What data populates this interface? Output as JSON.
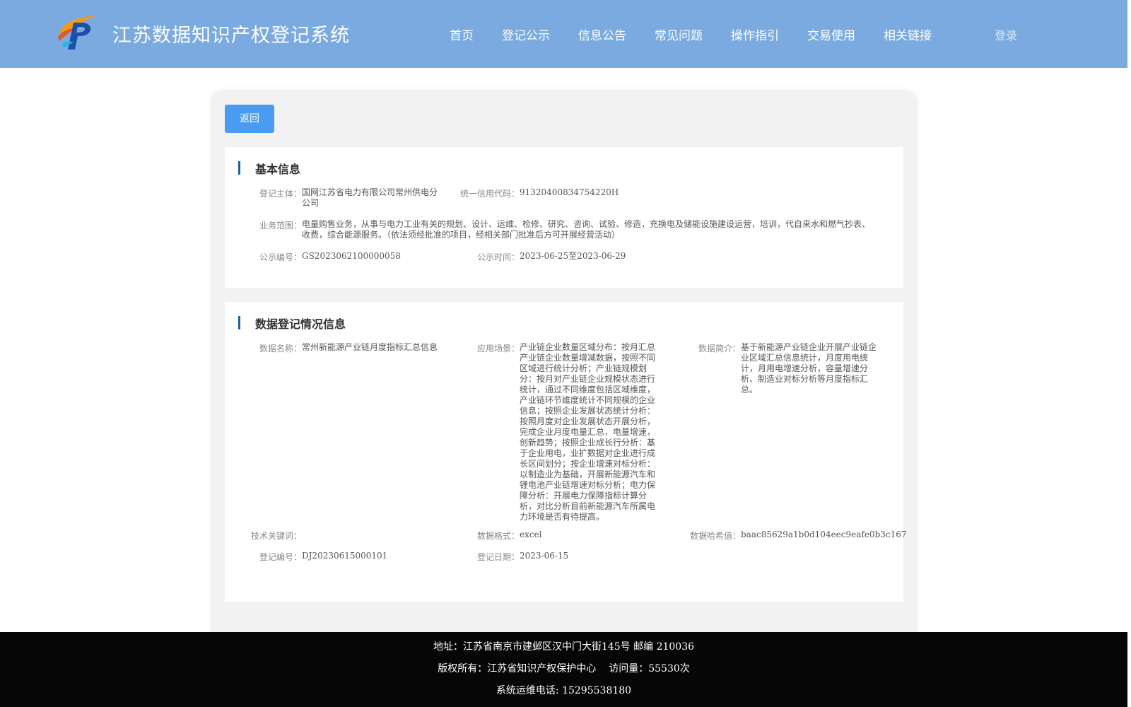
{
  "header": {
    "site_title": "江苏数据知识产权登记系统",
    "nav": [
      "首页",
      "登记公示",
      "信息公告",
      "常见问题",
      "操作指引",
      "交易使用",
      "相关链接"
    ],
    "login_label": "登录"
  },
  "main": {
    "back_label": "返回",
    "basic_info": {
      "title": "基本信息",
      "subject_label": "登记主体：",
      "subject_value": "国网江苏省电力有限公司常州供电分公司",
      "credit_label": "统一信用代码：",
      "credit_value": "91320400834754220H",
      "scope_label": "业务范围：",
      "scope_value": "电量购售业务，从事与电力工业有关的规划、设计、运维、检修、研究、咨询、试验、修造，充换电及储能设施建设运营，培训，代自来水和燃气抄表、收费，综合能源服务。（依法须经批准的项目，经相关部门批准后方可开展经营活动）",
      "pub_no_label": "公示编号：",
      "pub_no_value": "GS2023062100000058",
      "pub_time_label": "公示时间：",
      "pub_time_value": "2023-06-25至2023-06-29"
    },
    "registration": {
      "title": "数据登记情况信息",
      "data_name_label": "数据名称：",
      "data_name_value": "常州新能源产业链月度指标汇总信息",
      "scenario_label": "应用场景：",
      "scenario_value": "产业链企业数量区域分布：按月汇总产业链企业数量增减数据，按照不同区域进行统计分析；产业链规模划分：按月对产业链企业规模状态进行统计，通过不同维度包括区域维度，产业链环节维度统计不同规模的企业信息；按照企业发展状态统计分析：按照月度对企业发展状态开展分析，完成企业月度电量汇总，电量增速，创新趋势；按照企业成长行分析：基于企业用电，业扩数据对企业进行成长区间划分；按企业增速对标分析：以制造业为基础，开展新能源汽车和锂电池产业链增速对标分析；电力保障分析：开展电力保障指标计算分析，对比分析目前新能源汽车所属电力环境是否有待提高。",
      "intro_label": "数据简介：",
      "intro_value": "基于新能源产业链企业开展产业链企业区域汇总信息统计，月度用电统计，月用电增速分析，容量增速分析、制造业对标分析等月度指标汇总。",
      "keywords_label": "技术关键词：",
      "keywords_value": "",
      "format_label": "数据格式：",
      "format_value": "excel",
      "hash_label": "数据哈希值：",
      "hash_value": "baac85629a1b0d104eec9eafe0b3c167",
      "reg_no_label": "登记编号：",
      "reg_no_value": "DJ20230615000101",
      "reg_date_label": "登记日期：",
      "reg_date_value": "2023-06-15"
    }
  },
  "footer": {
    "address": "地址：江苏省南京市建邺区汉中门大街145号 邮编 210036",
    "copyright": "版权所有：江苏省知识产权保护中心",
    "visits": "访问量：55530次",
    "phone": "系统运维电话: 15295538180"
  },
  "colors": {
    "header_bg": "#7aaadf",
    "button_blue": "#4a9cf2",
    "section_bar": "#1c5ea8",
    "footer_bg": "#060606"
  },
  "icons": [
    "jiangsu-ip-logo-icon"
  ]
}
